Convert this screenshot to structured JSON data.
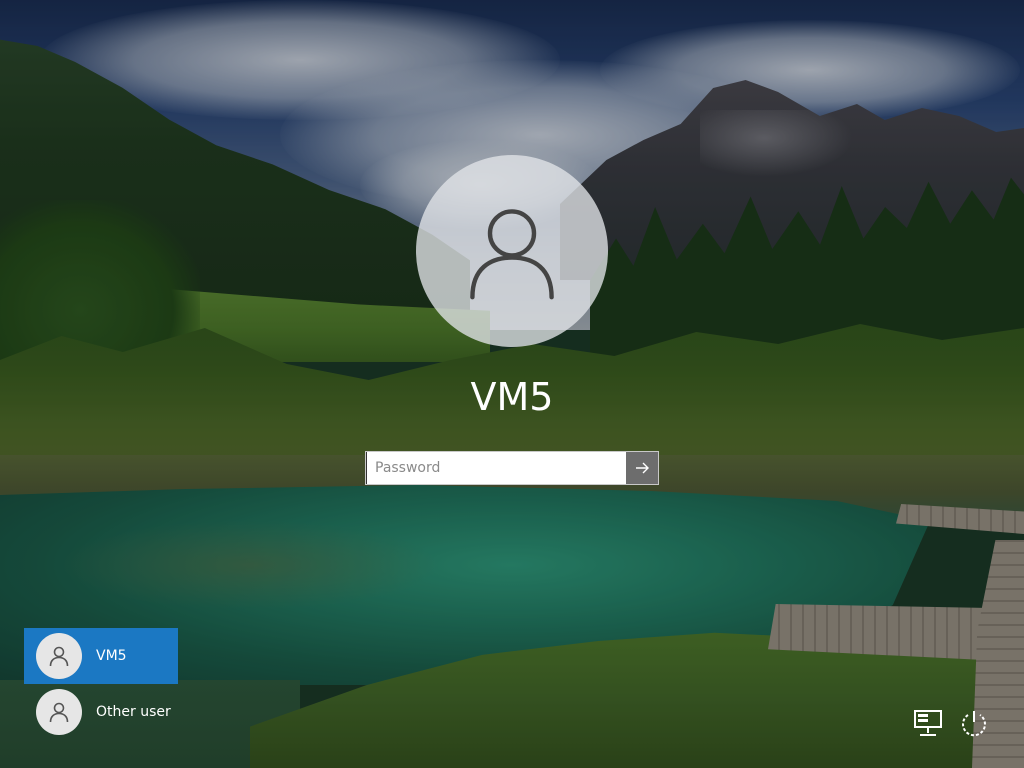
{
  "login": {
    "selected_user": "VM5",
    "password_placeholder": "Password"
  },
  "users": [
    {
      "label": "VM5",
      "selected": true
    },
    {
      "label": "Other user",
      "selected": false
    }
  ],
  "icons": {
    "avatar": "user-icon",
    "submit": "arrow-right-icon",
    "network": "network-icon",
    "power": "power-icon"
  },
  "colors": {
    "selected_user_bg": "#1b78c3",
    "submit_button_bg": "#6d6d6d"
  }
}
